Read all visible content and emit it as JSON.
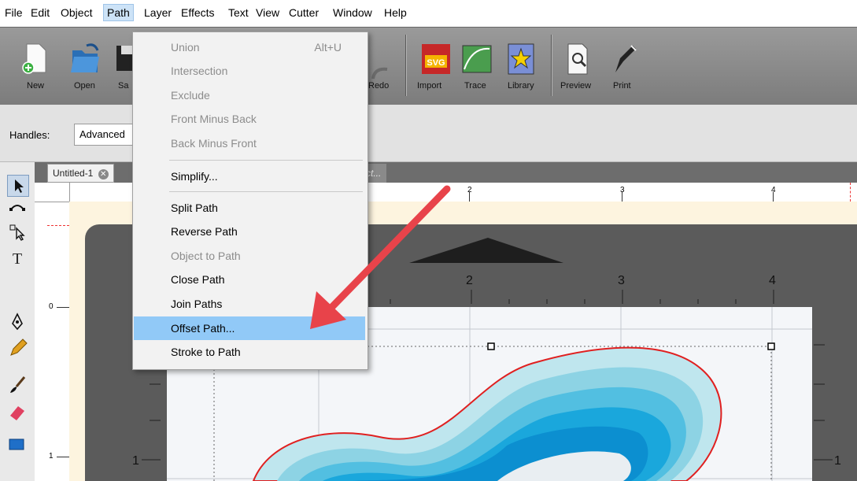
{
  "menubar": {
    "items": [
      "File",
      "Edit",
      "Object",
      "Path",
      "Layer",
      "Effects",
      "Text",
      "View",
      "Cutter",
      "Window",
      "Help"
    ],
    "active": "Path"
  },
  "toolbar": {
    "new": "New",
    "open": "Open",
    "save": "Sa",
    "redo": "Redo",
    "import": "Import",
    "trace": "Trace",
    "library": "Library",
    "preview": "Preview",
    "print": "Print",
    "import_badge": "SVG"
  },
  "options": {
    "handles_label": "Handles:",
    "handles_value": "Advanced"
  },
  "tabs": {
    "doc1": "Untitled-1",
    "doc2": "oject..."
  },
  "ruler": {
    "top_labels": [
      "2",
      "3",
      "4"
    ],
    "left_labels": [
      "0",
      "1"
    ]
  },
  "mat": {
    "labels_top": [
      "2",
      "3",
      "4"
    ],
    "labels_side": [
      "1",
      "1"
    ]
  },
  "path_menu": {
    "items": [
      {
        "label": "Union",
        "shortcut": "Alt+U",
        "disabled": true
      },
      {
        "label": "Intersection",
        "disabled": true
      },
      {
        "label": "Exclude",
        "disabled": true
      },
      {
        "label": "Front Minus Back",
        "disabled": true
      },
      {
        "label": "Back Minus Front",
        "disabled": true
      },
      {
        "label": "Simplify...",
        "disabled": false
      },
      {
        "label": "Split Path",
        "disabled": false
      },
      {
        "label": "Reverse Path",
        "disabled": false
      },
      {
        "label": "Object to Path",
        "disabled": true
      },
      {
        "label": "Close Path",
        "disabled": false
      },
      {
        "label": "Join Paths",
        "disabled": false
      },
      {
        "label": "Offset Path...",
        "disabled": false,
        "highlighted": true
      },
      {
        "label": "Stroke to Path",
        "disabled": false
      }
    ]
  },
  "colors": {
    "highlight": "#91c9f7",
    "arrow": "#e8434a",
    "shape_outline": "#e02020",
    "shape_fills": [
      "#b9e2ea",
      "#86d1e3",
      "#4dbde0",
      "#17a5dc",
      "#0a8fd1"
    ]
  }
}
